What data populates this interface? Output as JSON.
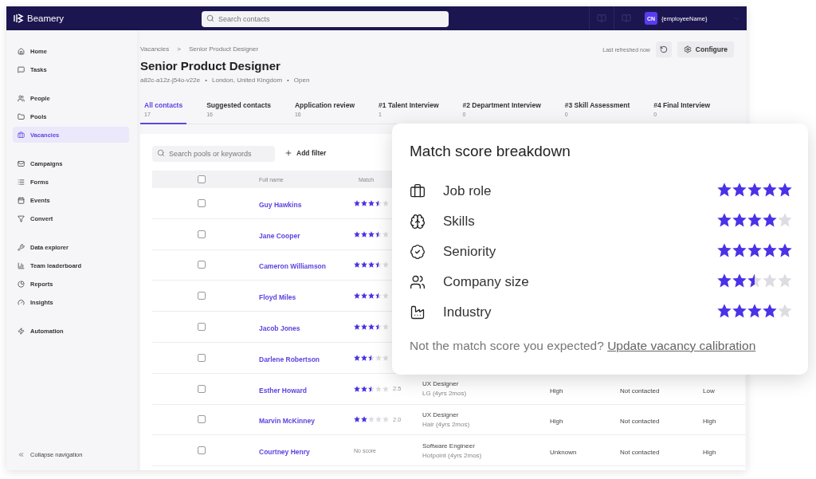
{
  "topbar": {
    "brand": "Beamery",
    "search": {
      "placeholder": "Search contacts"
    },
    "avatar": "CN",
    "user": "{employeeName}"
  },
  "sidebar": {
    "groups": [
      [
        {
          "label": "Home",
          "selected": false
        },
        {
          "label": "Tasks",
          "selected": false
        }
      ],
      [
        {
          "label": "People",
          "selected": false
        },
        {
          "label": "Pools",
          "selected": false
        },
        {
          "label": "Vacancies",
          "selected": true
        }
      ],
      [
        {
          "label": "Campaigns",
          "selected": false
        },
        {
          "label": "Forms",
          "selected": false
        },
        {
          "label": "Events",
          "selected": false
        },
        {
          "label": "Convert",
          "selected": false
        }
      ],
      [
        {
          "label": "Data explorer",
          "selected": false
        },
        {
          "label": "Team leaderboard",
          "selected": false
        },
        {
          "label": "Reports",
          "selected": false
        },
        {
          "label": "Insights",
          "selected": false
        }
      ],
      [
        {
          "label": "Automation",
          "selected": false
        }
      ]
    ],
    "collapse": "Collapse navigation"
  },
  "page": {
    "breadcrumb": [
      "Vacancies",
      "Senior Product Designer"
    ],
    "breadcrumb_separator": ">",
    "title": "Senior Product Designer",
    "meta": [
      "a82c-a12z-j54o-v22e",
      "London, United Kingdom",
      "Open"
    ],
    "meta_separator": "•",
    "refreshed": "Last refreshed now",
    "configure": "Configure"
  },
  "tabs": [
    {
      "label": "All contacts",
      "count": "17",
      "selected": true
    },
    {
      "label": "Suggested contacts",
      "count": "16",
      "selected": false
    },
    {
      "label": "Application review",
      "count": "16",
      "selected": false
    },
    {
      "label": "#1 Talent Interview",
      "count": "1",
      "selected": false
    },
    {
      "label": "#2 Department Interview",
      "count": "0",
      "selected": false
    },
    {
      "label": "#3 Skill Assessment",
      "count": "0",
      "selected": false
    },
    {
      "label": "#4 Final Interview",
      "count": "0",
      "selected": false
    }
  ],
  "filters": {
    "search": {
      "placeholder": "Search pools or keywords"
    },
    "add_filter": "Add filter"
  },
  "table": {
    "columns": [
      "Full name",
      "Match"
    ],
    "all_checked": false,
    "rows": [
      {
        "name": "Guy Hawkins",
        "checked": false,
        "stars": 3.5
      },
      {
        "name": "Jane Cooper",
        "checked": false,
        "stars": 3.5
      },
      {
        "name": "Cameron Williamson",
        "checked": false,
        "stars": 3.5
      },
      {
        "name": "Floyd Miles",
        "checked": false,
        "stars": 3.5
      },
      {
        "name": "Jacob Jones",
        "checked": false,
        "stars": 3.5
      },
      {
        "name": "Darlene Robertson",
        "checked": false,
        "stars": 2.5
      },
      {
        "name": "Esther Howard",
        "checked": false,
        "stars": 2.5,
        "score": "2.5",
        "job": "UX Designer",
        "company": "LG (4yrs 2mos)",
        "column_5": "High",
        "column_6": "Not contacted",
        "column_7": "Low"
      },
      {
        "name": "Marvin McKinney",
        "checked": false,
        "stars": 2,
        "score": "2.0",
        "job": "UX Designer",
        "company": "Hair (4yrs 2mos)",
        "column_5": "High",
        "column_6": "Not contacted",
        "column_7": "High"
      },
      {
        "name": "Courtney Henry",
        "checked": false,
        "no_score": "No score",
        "job": "Software Engineer",
        "company": "Hotpoint (4yrs 2mos)",
        "column_5": "Unknown",
        "column_6": "Not contacted",
        "column_7": "High"
      }
    ]
  },
  "popover": {
    "title": "Match score breakdown",
    "criteria": [
      {
        "label": "Job role",
        "stars": 5
      },
      {
        "label": "Skills",
        "stars": 4
      },
      {
        "label": "Seniority",
        "stars": 5
      },
      {
        "label": "Company size",
        "stars": 2.5
      },
      {
        "label": "Industry",
        "stars": 4
      }
    ],
    "note": "Not the match score you expected?",
    "link": "Update vacancy calibration"
  }
}
